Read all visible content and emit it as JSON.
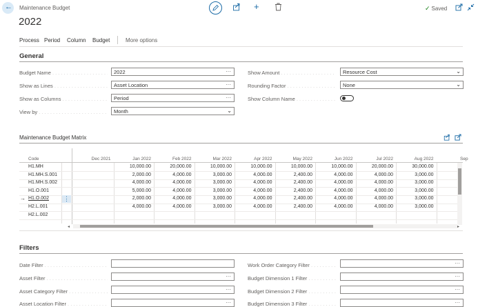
{
  "header": {
    "breadcrumb": "Maintenance Budget",
    "title": "2022",
    "saved_label": "Saved"
  },
  "menu": {
    "items": [
      "Process",
      "Period",
      "Column",
      "Budget"
    ],
    "more": "More options"
  },
  "general": {
    "title": "General",
    "fields_left": [
      {
        "label": "Budget Name",
        "value": "2022",
        "kind": "lookup"
      },
      {
        "label": "Show as Lines",
        "value": "Asset Location",
        "kind": "lookup"
      },
      {
        "label": "Show as Columns",
        "value": "Period",
        "kind": "lookup"
      },
      {
        "label": "View by",
        "value": "Month",
        "kind": "select"
      }
    ],
    "fields_right": [
      {
        "label": "Show Amount",
        "value": "Resource Cost",
        "kind": "select"
      },
      {
        "label": "Rounding Factor",
        "value": "None",
        "kind": "select"
      },
      {
        "label": "Show Column Name",
        "value": "",
        "kind": "toggle"
      }
    ]
  },
  "matrix": {
    "title": "Maintenance Budget Matrix",
    "code_header": "Code",
    "columns": [
      "Dec 2021",
      "Jan 2022",
      "Feb 2022",
      "Mar 2022",
      "Apr 2022",
      "May 2022",
      "Jun 2022",
      "Jul 2022",
      "Aug 2022",
      "Sep"
    ],
    "rows": [
      {
        "code": "H1.MH",
        "values": [
          "",
          "10,000.00",
          "20,000.00",
          "10,000.00",
          "10,000.00",
          "10,000.00",
          "10,000.00",
          "20,000.00",
          "30,000.00"
        ]
      },
      {
        "code": "H1.MH.S.001",
        "values": [
          "",
          "2,000.00",
          "4,000.00",
          "3,000.00",
          "4,000.00",
          "2,400.00",
          "4,000.00",
          "4,000.00",
          "3,000.00"
        ]
      },
      {
        "code": "H1.MH.S.002",
        "values": [
          "",
          "4,000.00",
          "4,000.00",
          "3,000.00",
          "4,000.00",
          "2,400.00",
          "4,000.00",
          "4,000.00",
          "3,000.00"
        ]
      },
      {
        "code": "H1.O.001",
        "values": [
          "",
          "5,000.00",
          "4,000.00",
          "3,000.00",
          "4,000.00",
          "2,400.00",
          "4,000.00",
          "4,000.00",
          "3,000.00"
        ]
      },
      {
        "code": "H1.O.002",
        "values": [
          "",
          "2,000.00",
          "4,000.00",
          "3,000.00",
          "4,000.00",
          "2,400.00",
          "4,000.00",
          "4,000.00",
          "3,000.00"
        ]
      },
      {
        "code": "H2.L.001",
        "values": [
          "",
          "4,000.00",
          "4,000.00",
          "3,000.00",
          "4,000.00",
          "2,400.00",
          "4,000.00",
          "4,000.00",
          "3,000.00"
        ]
      },
      {
        "code": "H2.L.002",
        "values": [
          "",
          "",
          "",
          "",
          "",
          "",
          "",
          "",
          ""
        ]
      }
    ],
    "selected_row": 4
  },
  "filters": {
    "title": "Filters",
    "left": [
      "Date Filter",
      "Asset Filter",
      "Asset Category Filter",
      "Asset Location Filter"
    ],
    "right": [
      "Work Order Category Filter",
      "Budget Dimension 1 Filter",
      "Budget Dimension 2 Filter",
      "Budget Dimension 3 Filter"
    ]
  },
  "icons": {
    "back": "back-arrow-icon",
    "edit": "edit-pencil-icon",
    "share": "share-icon",
    "add": "plus-icon",
    "delete": "trash-icon",
    "open_new": "open-in-new-window-icon",
    "collapse": "collapse-icon"
  },
  "colors": {
    "accent": "#1a6aa6",
    "saved_check": "#107c10"
  }
}
